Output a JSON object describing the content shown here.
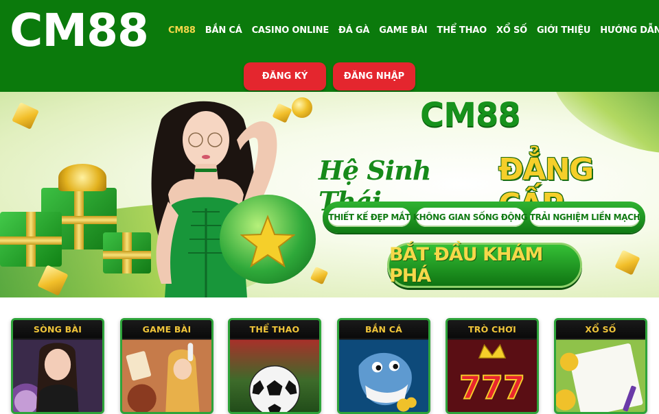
{
  "header": {
    "logo": "CM88",
    "nav": [
      {
        "label": "CM88",
        "active": true
      },
      {
        "label": "BẮN CÁ"
      },
      {
        "label": "CASINO ONLINE"
      },
      {
        "label": "ĐÁ GÀ"
      },
      {
        "label": "GAME BÀI"
      },
      {
        "label": "THỂ THAO"
      },
      {
        "label": "XỔ SỐ"
      },
      {
        "label": "GIỚI THIỆU"
      },
      {
        "label": "HƯỚNG DẪN",
        "has_dropdown": true
      }
    ],
    "register_label": "ĐĂNG KÝ",
    "login_label": "ĐĂNG NHẬP"
  },
  "banner": {
    "logo": "CM88",
    "tagline_script": "Hệ Sinh Thái",
    "tagline_highlight": "ĐẲNG CẤP",
    "pills": [
      "THIẾT KẾ ĐẸP MẮT",
      "KHÔNG GIAN SỐNG ĐỘNG",
      "TRẢI NGHIỆM LIỀN MẠCH"
    ],
    "cta_label": "BẮT ĐẦU KHÁM PHÁ"
  },
  "games": [
    {
      "label": "SÒNG BÀI"
    },
    {
      "label": "GAME BÀI"
    },
    {
      "label": "THỂ THAO"
    },
    {
      "label": "BẮN CÁ"
    },
    {
      "label": "TRÒ CHƠI"
    },
    {
      "label": "XỔ SỐ"
    }
  ],
  "colors": {
    "header_bg": "#0b7a0c",
    "nav_active": "#f3d64a",
    "button_red": "#e4262e",
    "brand_green": "#17921c",
    "gold": "#f5cf2a"
  },
  "icons": {
    "nav_dropdown": "chevron-down-icon"
  }
}
